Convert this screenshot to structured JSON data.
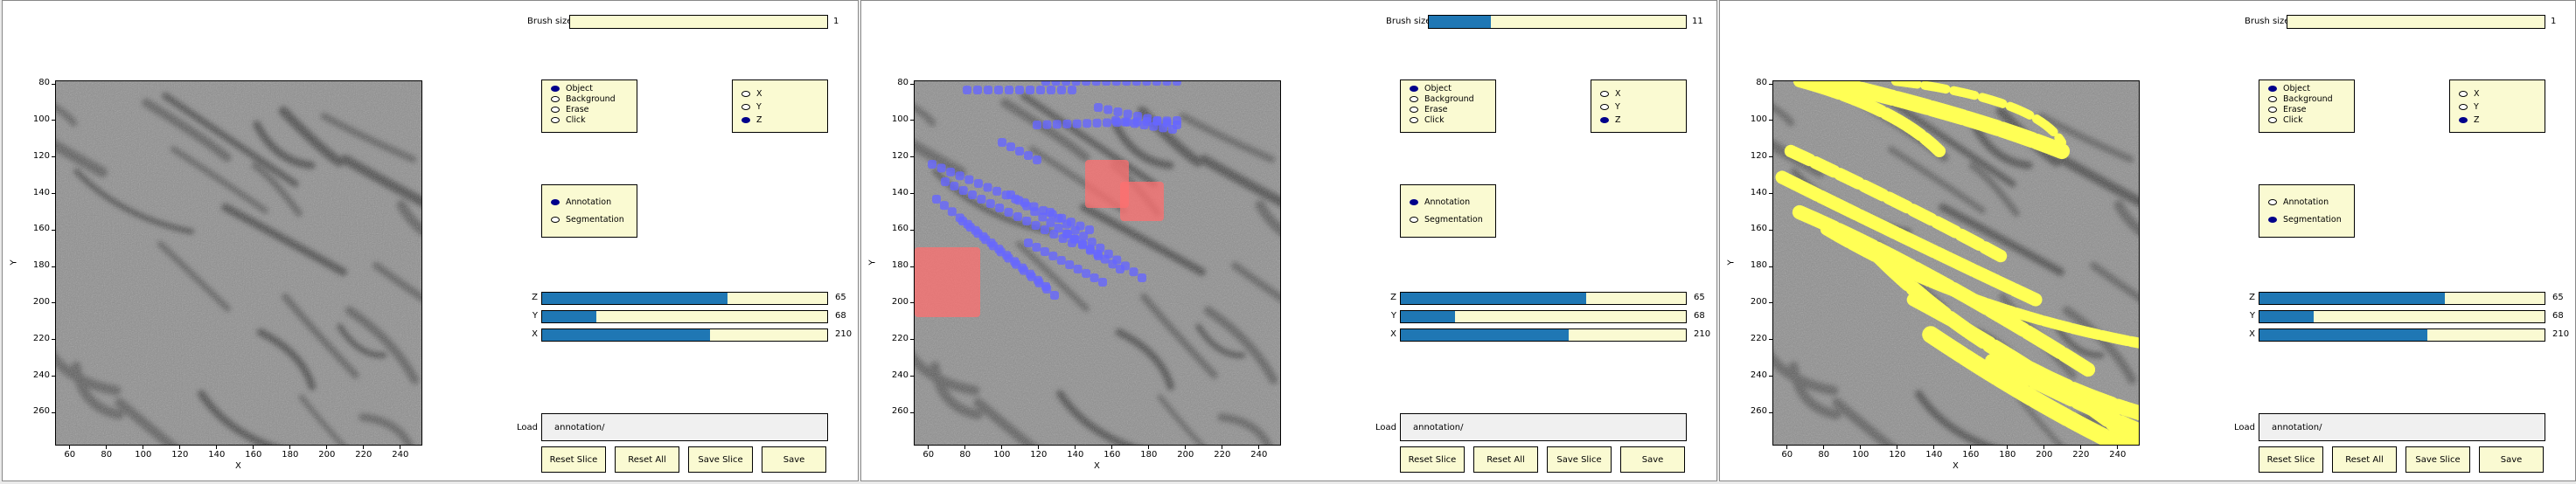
{
  "panels": [
    {
      "brush_label": "Brush size",
      "brush_value": "1",
      "brush_fraction": 0.0,
      "modes": [
        {
          "label": "Object",
          "selected": true
        },
        {
          "label": "Background",
          "selected": false
        },
        {
          "label": "Erase",
          "selected": false
        },
        {
          "label": "Click",
          "selected": false
        }
      ],
      "axes": [
        {
          "label": "X",
          "selected": false
        },
        {
          "label": "Y",
          "selected": false
        },
        {
          "label": "Z",
          "selected": true
        }
      ],
      "views": [
        {
          "label": "Annotation",
          "selected": true
        },
        {
          "label": "Segmentation",
          "selected": false
        }
      ],
      "sliders": [
        {
          "label": "Z",
          "value": "65",
          "fraction": 0.65
        },
        {
          "label": "Y",
          "value": "68",
          "fraction": 0.19
        },
        {
          "label": "X",
          "value": "210",
          "fraction": 0.59
        }
      ],
      "load_label": "Load",
      "load_value": "annotation/",
      "buttons": [
        "Reset Slice",
        "Reset All",
        "Save Slice",
        "Save"
      ],
      "overlay": "none"
    },
    {
      "brush_label": "Brush size",
      "brush_value": "11",
      "brush_fraction": 0.24,
      "modes": [
        {
          "label": "Object",
          "selected": true
        },
        {
          "label": "Background",
          "selected": false
        },
        {
          "label": "Erase",
          "selected": false
        },
        {
          "label": "Click",
          "selected": false
        }
      ],
      "axes": [
        {
          "label": "X",
          "selected": false
        },
        {
          "label": "Y",
          "selected": false
        },
        {
          "label": "Z",
          "selected": true
        }
      ],
      "views": [
        {
          "label": "Annotation",
          "selected": true
        },
        {
          "label": "Segmentation",
          "selected": false
        }
      ],
      "sliders": [
        {
          "label": "Z",
          "value": "65",
          "fraction": 0.65
        },
        {
          "label": "Y",
          "value": "68",
          "fraction": 0.19
        },
        {
          "label": "X",
          "value": "210",
          "fraction": 0.59
        }
      ],
      "load_label": "Load",
      "load_value": "annotation/",
      "buttons": [
        "Reset Slice",
        "Reset All",
        "Save Slice",
        "Save"
      ],
      "overlay": "annotation"
    },
    {
      "brush_label": "Brush size",
      "brush_value": "1",
      "brush_fraction": 0.0,
      "modes": [
        {
          "label": "Object",
          "selected": true
        },
        {
          "label": "Background",
          "selected": false
        },
        {
          "label": "Erase",
          "selected": false
        },
        {
          "label": "Click",
          "selected": false
        }
      ],
      "axes": [
        {
          "label": "X",
          "selected": false
        },
        {
          "label": "Y",
          "selected": false
        },
        {
          "label": "Z",
          "selected": true
        }
      ],
      "views": [
        {
          "label": "Annotation",
          "selected": false
        },
        {
          "label": "Segmentation",
          "selected": true
        }
      ],
      "sliders": [
        {
          "label": "Z",
          "value": "65",
          "fraction": 0.65
        },
        {
          "label": "Y",
          "value": "68",
          "fraction": 0.19
        },
        {
          "label": "X",
          "value": "210",
          "fraction": 0.59
        }
      ],
      "load_label": "Load",
      "load_value": "annotation/",
      "buttons": [
        "Reset Slice",
        "Reset All",
        "Save Slice",
        "Save"
      ],
      "overlay": "segmentation"
    }
  ],
  "image_plot": {
    "x_ticks": [
      "60",
      "80",
      "100",
      "120",
      "140",
      "160",
      "180",
      "200",
      "220",
      "240"
    ],
    "y_ticks": [
      "80",
      "100",
      "120",
      "140",
      "160",
      "180",
      "200",
      "220",
      "240",
      "260"
    ],
    "x_label": "X",
    "y_label": "Y",
    "x_range": [
      52,
      252
    ],
    "y_range": [
      78,
      278
    ]
  },
  "colors": {
    "widget_bg": "#fafad2",
    "slider_fill": "#1f77b4",
    "radio_on": "#00008b",
    "annotation_object": "#6666ff",
    "annotation_background": "#ff6f6f",
    "segmentation": "#ffff55"
  }
}
